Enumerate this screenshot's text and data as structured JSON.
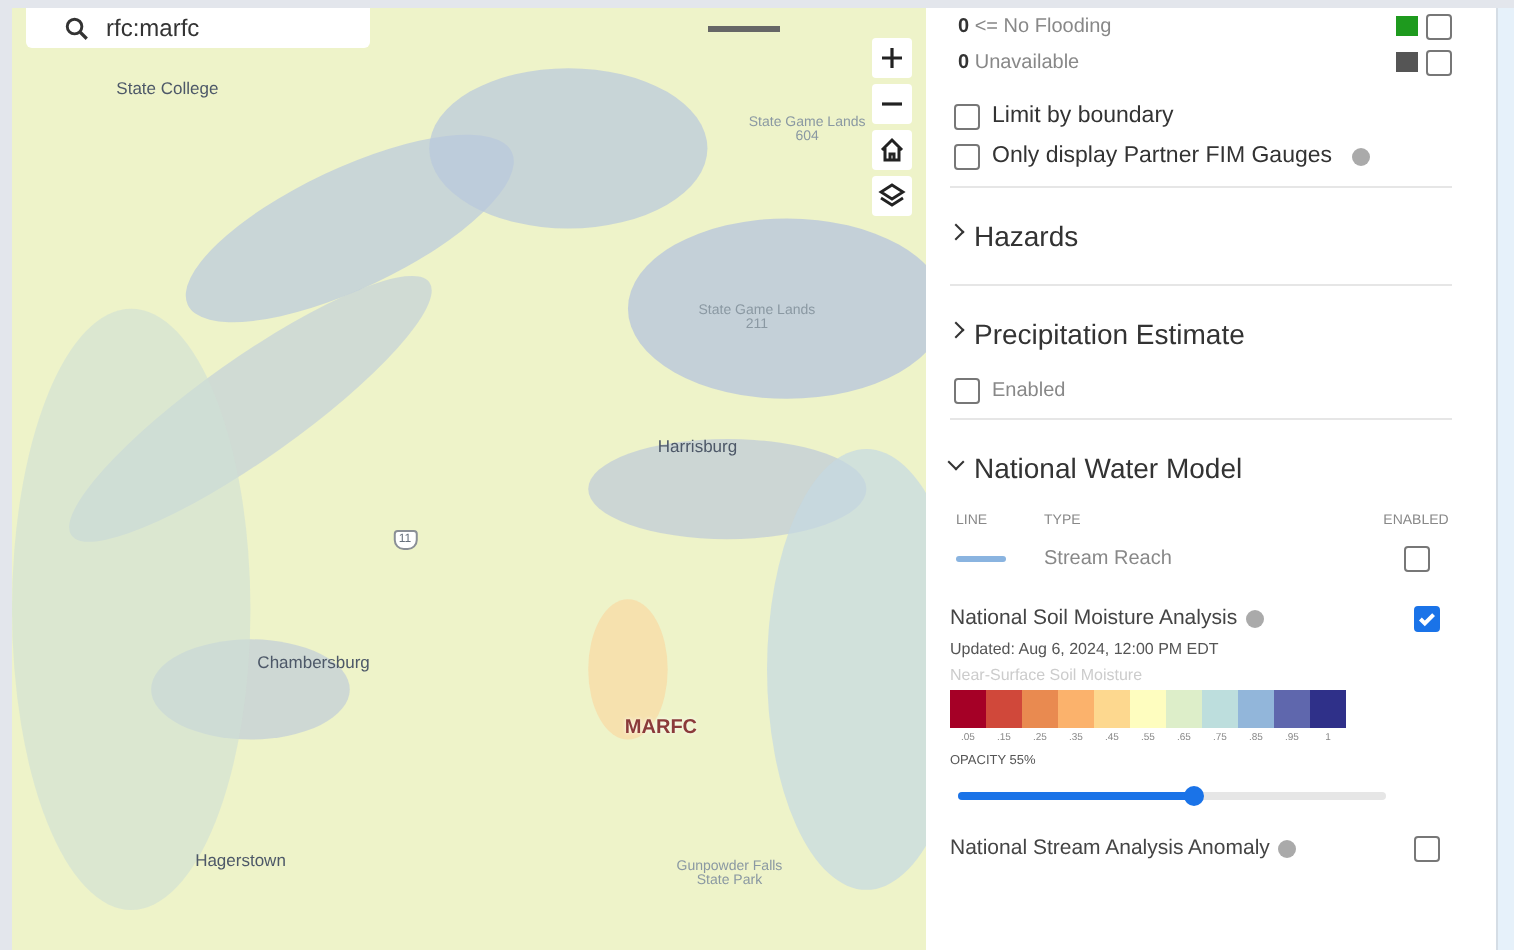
{
  "search": {
    "value": "rfc:marfc"
  },
  "map": {
    "labels": [
      {
        "text": "State College",
        "kind": "city"
      },
      {
        "text": "State Game Lands 604",
        "kind": "park"
      },
      {
        "text": "State Game Lands 211",
        "kind": "park"
      },
      {
        "text": "Harrisburg",
        "kind": "city"
      },
      {
        "text": "11",
        "kind": "shield"
      },
      {
        "text": "Chambersburg",
        "kind": "city"
      },
      {
        "text": "MARFC",
        "kind": "region"
      },
      {
        "text": "Hagerstown",
        "kind": "city"
      },
      {
        "text": "Gunpowder Falls State Park",
        "kind": "park"
      }
    ]
  },
  "panel": {
    "flood_rows": [
      {
        "count": "0",
        "label": "<= No Flooding",
        "color": "#1e9a1e",
        "checked": false
      },
      {
        "count": "0",
        "label": "Unavailable",
        "color": "#555555",
        "checked": false
      }
    ],
    "options": [
      {
        "label": "Limit by boundary",
        "checked": false,
        "info": false
      },
      {
        "label": "Only display Partner FIM Gauges",
        "checked": false,
        "info": true
      }
    ],
    "hazards": {
      "title": "Hazards",
      "expanded": false
    },
    "precipitation": {
      "title": "Precipitation Estimate",
      "expanded": false,
      "enabled": {
        "label": "Enabled",
        "checked": false
      }
    },
    "nwm": {
      "title": "National Water Model",
      "expanded": true,
      "columns": [
        "LINE",
        "TYPE",
        "ENABLED"
      ],
      "rows": [
        {
          "type": "Stream Reach",
          "color": "#8ab4e0",
          "checked": false
        }
      ],
      "soil": {
        "title": "National Soil Moisture Analysis",
        "checked": true,
        "updated": "Updated: Aug 6, 2024, 12:00 PM EDT",
        "subtitle": "Near-Surface Soil Moisture",
        "swatches": [
          {
            "color": "#a50026",
            "label": ".05"
          },
          {
            "color": "#d0483a",
            "label": ".15"
          },
          {
            "color": "#e98a50",
            "label": ".25"
          },
          {
            "color": "#fbb26c",
            "label": ".35"
          },
          {
            "color": "#fdd88f",
            "label": ".45"
          },
          {
            "color": "#fefdbf",
            "label": ".55"
          },
          {
            "color": "#ddeec9",
            "label": ".65"
          },
          {
            "color": "#bddedd",
            "label": ".75"
          },
          {
            "color": "#92b6da",
            "label": ".85"
          },
          {
            "color": "#5f67ad",
            "label": ".95"
          },
          {
            "color": "#2f3089",
            "label": "1"
          }
        ],
        "opacity_label": "OPACITY 55%",
        "level": 0.55
      },
      "anomaly": {
        "title": "National Stream Analysis Anomaly",
        "checked": false,
        "info": true
      }
    }
  }
}
